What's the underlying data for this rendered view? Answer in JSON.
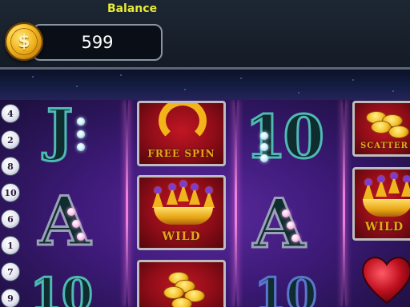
{
  "header": {
    "balance_title": "Balance",
    "balance_value": "599",
    "coin_symbol": "$"
  },
  "paylines": [
    "4",
    "2",
    "8",
    "10",
    "6",
    "1",
    "7",
    "9"
  ],
  "reels": {
    "letters": {
      "j": "J",
      "ten": "10",
      "a": "A"
    },
    "tiles": {
      "free_spin": "FREE SPIN",
      "wild": "WILD",
      "scatter": "SCATTER"
    }
  },
  "colors": {
    "balance_title": "#e7ea36",
    "reel_background": "#3d1a78",
    "tile_red": "#8f0d18",
    "letter_teal": "#4fb9b4"
  }
}
